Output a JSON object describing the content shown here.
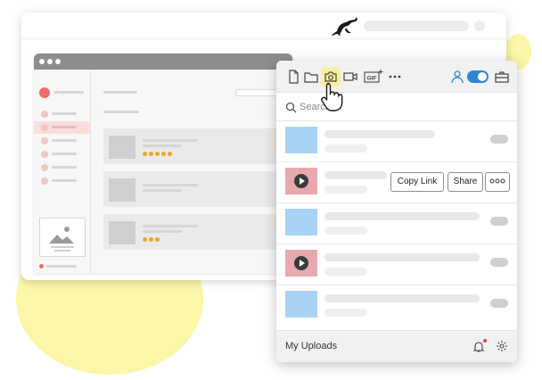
{
  "search": {
    "placeholder": "Search"
  },
  "actions": {
    "copy_link": "Copy Link",
    "share": "Share"
  },
  "toolbar": {
    "gif_label": "GIF"
  },
  "footer": {
    "label": "My Uploads"
  },
  "colors": {
    "toggle_on": "#2f86d6",
    "camera_highlight": "#f8ef9a",
    "notification_dot": "#e04848",
    "image_thumb": "#a9d3f5",
    "video_thumb": "#e8a9ae",
    "backdrop_blob": "#fbf6a8"
  },
  "icons": [
    "kangaroo-logo",
    "document-icon",
    "folder-icon",
    "camera-icon",
    "video-camera-icon",
    "gif-icon",
    "more-icon",
    "user-icon",
    "toggle",
    "briefcase-icon",
    "search-icon",
    "play-icon",
    "bell-icon",
    "gear-icon",
    "hand-cursor"
  ],
  "uploads": [
    {
      "kind": "image"
    },
    {
      "kind": "video"
    },
    {
      "kind": "image"
    },
    {
      "kind": "video"
    },
    {
      "kind": "image"
    }
  ]
}
